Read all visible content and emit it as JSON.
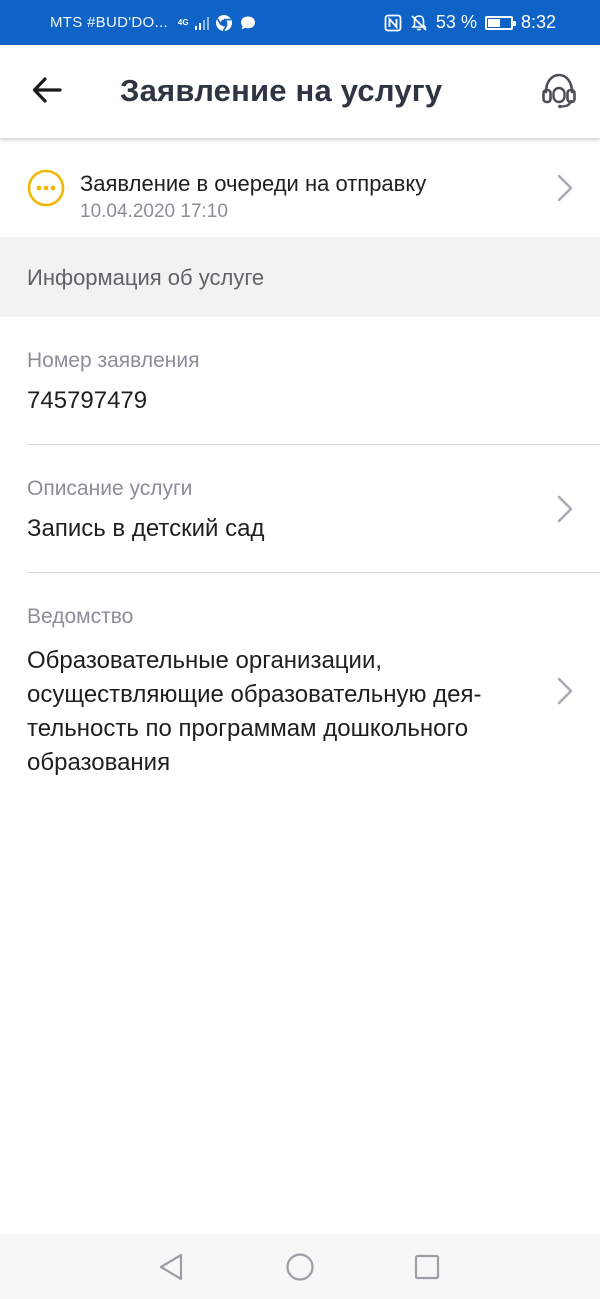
{
  "status_bar": {
    "carrier": "MTS #BUD'DO...",
    "network_tag": "4G",
    "battery_percent": "53 %",
    "battery_level": 0.53,
    "time": "8:32",
    "icons": [
      "signal-icon",
      "chrome-icon",
      "message-icon",
      "nfc-icon",
      "bell-off-icon",
      "battery-icon"
    ]
  },
  "app_bar": {
    "title": "Заявление на услугу",
    "back_icon": "arrow-left-icon",
    "support_icon": "headset-icon"
  },
  "status": {
    "title": "Заявление в очереди на отправку",
    "date": "10.04.2020 17:10",
    "icon": "pending-dots-icon",
    "accent_color": "#f2b705"
  },
  "section": {
    "title": "Информация об услуге"
  },
  "info": {
    "number_label": "Номер заявления",
    "number_value": "745797479",
    "description_label": "Описание услуги",
    "description_value": "Запись в детский сад",
    "department_label": "Ведомство",
    "department_line1": "Образовательные организации,",
    "department_line2": "осуществляющие образовательную дея-",
    "department_line3": "тельность по программам дошкольного",
    "department_line4": "образования"
  },
  "nav": {
    "icons": [
      "nav-back-icon",
      "nav-home-icon",
      "nav-recents-icon"
    ]
  },
  "colors": {
    "status_bar": "#0f62c6",
    "title_text": "#2f3542",
    "muted_text": "#8a8f96",
    "section_bg": "#f2f2f2"
  }
}
